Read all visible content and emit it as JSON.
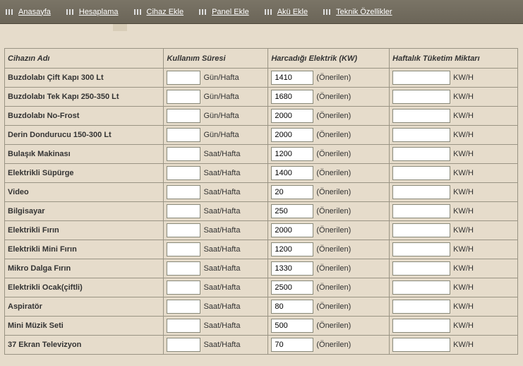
{
  "nav": [
    {
      "label": "Anasayfa"
    },
    {
      "label": "Hesaplama"
    },
    {
      "label": "Cihaz Ekle"
    },
    {
      "label": "Panel Ekle"
    },
    {
      "label": "Akü Ekle"
    },
    {
      "label": "Teknik Özellikler"
    }
  ],
  "headers": {
    "name": "Cihazın Adı",
    "usage": "Kullanım Süresi",
    "power": "Harcadığı Elektrik (KW)",
    "weekly": "Haftalık Tüketim Miktarı"
  },
  "labels": {
    "recommended": "(Önerilen)",
    "kwh": "KW/H",
    "day_week": "Gün/Hafta",
    "hour_week": "Saat/Hafta"
  },
  "rows": [
    {
      "name": "Buzdolabı Çift Kapı 300 Lt",
      "usage": "",
      "usage_unit": "day_week",
      "power": "1410",
      "weekly": ""
    },
    {
      "name": "Buzdolabı Tek Kapı 250-350 Lt",
      "usage": "",
      "usage_unit": "day_week",
      "power": "1680",
      "weekly": ""
    },
    {
      "name": "Buzdolabı No-Frost",
      "usage": "",
      "usage_unit": "day_week",
      "power": "2000",
      "weekly": ""
    },
    {
      "name": "Derin Dondurucu 150-300 Lt",
      "usage": "",
      "usage_unit": "day_week",
      "power": "2000",
      "weekly": ""
    },
    {
      "name": "Bulaşık Makinası",
      "usage": "",
      "usage_unit": "hour_week",
      "power": "1200",
      "weekly": ""
    },
    {
      "name": "Elektrikli Süpürge",
      "usage": "",
      "usage_unit": "hour_week",
      "power": "1400",
      "weekly": ""
    },
    {
      "name": "Video",
      "usage": "",
      "usage_unit": "hour_week",
      "power": "20",
      "weekly": ""
    },
    {
      "name": "Bilgisayar",
      "usage": "",
      "usage_unit": "hour_week",
      "power": "250",
      "weekly": ""
    },
    {
      "name": "Elektrikli Fırın",
      "usage": "",
      "usage_unit": "hour_week",
      "power": "2000",
      "weekly": ""
    },
    {
      "name": "Elektrikli Mini Fırın",
      "usage": "",
      "usage_unit": "hour_week",
      "power": "1200",
      "weekly": ""
    },
    {
      "name": "Mikro Dalga Fırın",
      "usage": "",
      "usage_unit": "hour_week",
      "power": "1330",
      "weekly": ""
    },
    {
      "name": "Elektrikli Ocak(çiftli)",
      "usage": "",
      "usage_unit": "hour_week",
      "power": "2500",
      "weekly": ""
    },
    {
      "name": "Aspiratör",
      "usage": "",
      "usage_unit": "hour_week",
      "power": "80",
      "weekly": ""
    },
    {
      "name": "Mini Müzik Seti",
      "usage": "",
      "usage_unit": "hour_week",
      "power": "500",
      "weekly": ""
    },
    {
      "name": "37 Ekran Televizyon",
      "usage": "",
      "usage_unit": "hour_week",
      "power": "70",
      "weekly": ""
    }
  ]
}
